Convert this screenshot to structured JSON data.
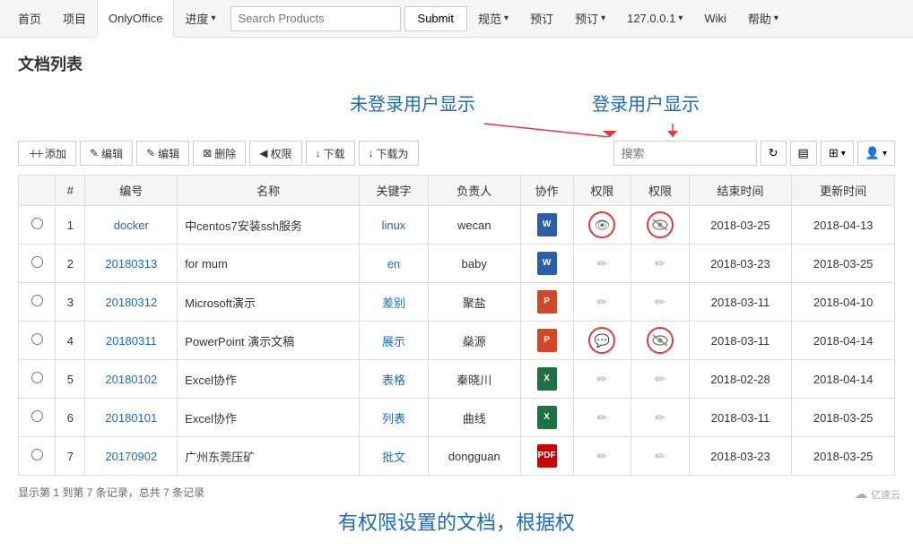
{
  "topnav": {
    "items": [
      {
        "label": "首页",
        "active": false
      },
      {
        "label": "项目",
        "active": false
      },
      {
        "label": "OnlyOffice",
        "active": true
      },
      {
        "label": "进度",
        "active": false,
        "caret": true
      }
    ],
    "search_placeholder": "Search Products",
    "submit_label": "Submit",
    "extra_items": [
      {
        "label": "规范",
        "caret": true
      },
      {
        "label": "预订"
      },
      {
        "label": "预订",
        "caret": true
      },
      {
        "label": "127.0.0.1",
        "caret": true
      },
      {
        "label": "Wiki"
      },
      {
        "label": "帮助",
        "caret": true
      }
    ]
  },
  "page": {
    "title": "文档列表"
  },
  "annotations": {
    "left_label": "未登录用户显示",
    "right_label": "登录用户显示",
    "bottom_label": "有权限设置的文档，根据权"
  },
  "toolbar": {
    "add_label": "＋添加",
    "edit1_label": "✎编辑",
    "edit2_label": "✎编辑",
    "delete_label": "⊠删除",
    "permission_label": "◀权限",
    "download_label": "↓下载",
    "download_as_label": "↓下载为",
    "search_placeholder": "搜索"
  },
  "table": {
    "headers": [
      "#",
      "编号",
      "名称",
      "关键字",
      "负责人",
      "协作",
      "权限",
      "权限",
      "结束时间",
      "更新时间"
    ],
    "rows": [
      {
        "id": 1,
        "number": "docker",
        "name": "中centos7安装ssh服务",
        "keyword": "linux",
        "owner": "wecan",
        "collab": "W",
        "collab_type": "word",
        "perm1": "eye",
        "perm2": "eye-slash",
        "perm1_circled": true,
        "perm2_circled": true,
        "end_date": "2018-03-25",
        "update_date": "2018-04-13"
      },
      {
        "id": 2,
        "number": "20180313",
        "name": "for mum",
        "keyword": "en",
        "owner": "baby",
        "collab": "W",
        "collab_type": "word",
        "perm1": "edit",
        "perm2": "edit",
        "perm1_circled": false,
        "perm2_circled": false,
        "end_date": "2018-03-23",
        "update_date": "2018-03-25"
      },
      {
        "id": 3,
        "number": "20180312",
        "name": "Microsoft演示",
        "keyword": "差别",
        "owner": "聚盐",
        "collab": "P",
        "collab_type": "ppt",
        "perm1": "edit",
        "perm2": "edit",
        "perm1_circled": false,
        "perm2_circled": false,
        "end_date": "2018-03-11",
        "update_date": "2018-04-10"
      },
      {
        "id": 4,
        "number": "20180311",
        "name": "PowerPoint 演示文稿",
        "keyword": "展示",
        "owner": "燊源",
        "collab": "P",
        "collab_type": "ppt",
        "perm1": "comment",
        "perm2": "eye-slash",
        "perm1_circled": true,
        "perm2_circled": true,
        "end_date": "2018-03-11",
        "update_date": "2018-04-14"
      },
      {
        "id": 5,
        "number": "20180102",
        "name": "Excel协作",
        "keyword": "表格",
        "owner": "秦晓川",
        "collab": "X",
        "collab_type": "excel",
        "perm1": "edit",
        "perm2": "edit",
        "perm1_circled": false,
        "perm2_circled": false,
        "end_date": "2018-02-28",
        "update_date": "2018-04-14"
      },
      {
        "id": 6,
        "number": "20180101",
        "name": "Excel协作",
        "keyword": "列表",
        "owner": "曲线",
        "collab": "X",
        "collab_type": "excel",
        "perm1": "edit",
        "perm2": "edit",
        "perm1_circled": false,
        "perm2_circled": false,
        "end_date": "2018-03-11",
        "update_date": "2018-03-25"
      },
      {
        "id": 7,
        "number": "20170902",
        "name": "广州东莞压矿",
        "keyword": "批文",
        "owner": "dongguan",
        "collab": "PDF",
        "collab_type": "pdf",
        "perm1": "edit",
        "perm2": "edit",
        "perm1_circled": false,
        "perm2_circled": false,
        "end_date": "2018-03-23",
        "update_date": "2018-03-25"
      }
    ]
  },
  "status": {
    "text": "显示第 1 到第 7 条记录，总共 7 条记录"
  },
  "watermark": {
    "text": "亿速云"
  }
}
